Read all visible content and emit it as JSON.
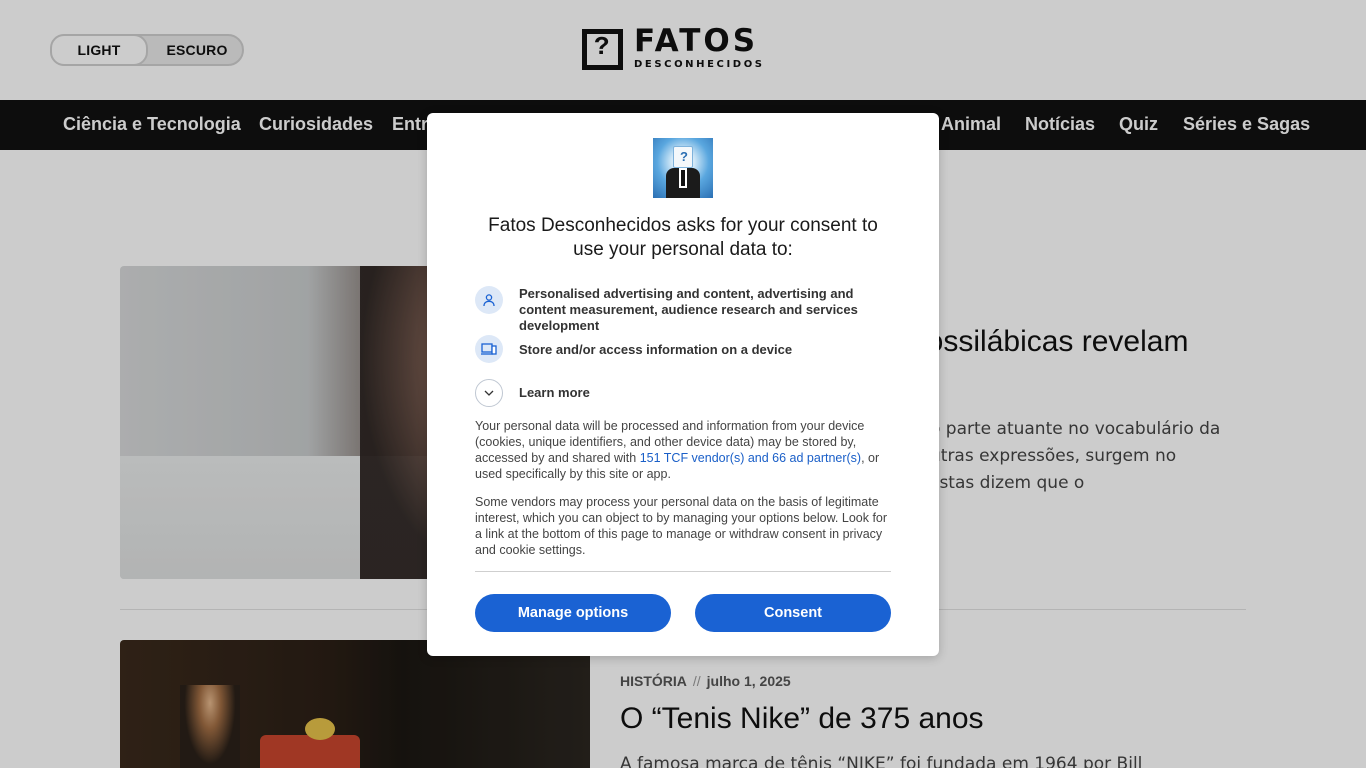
{
  "header": {
    "theme_light": "LIGHT",
    "theme_dark": "ESCURO",
    "logo_mark": "?",
    "logo_word": "FATOS",
    "logo_sub": "DESCONHECIDOS"
  },
  "nav": {
    "items": [
      "Ciência e Tecnologia",
      "Curiosidades",
      "Entr",
      "Animal",
      "Notícias",
      "Quiz",
      "Séries e Sagas"
    ]
  },
  "articles": [
    {
      "title_visible": "nossilábicas revelam",
      "excerpt_visible": "o parte atuante no vocabulário da\nutras expressões, surgem no\nlistas dizem que o"
    },
    {
      "category": "HISTÓRIA",
      "separator": "//",
      "date": "julho 1, 2025",
      "title": "O “Tenis Nike” de 375 anos",
      "excerpt": "A famosa marca de tênis “NIKE” foi fundada em 1964 por Bill"
    }
  ],
  "consent": {
    "title": "Fatos Desconhecidos asks for your consent to use your personal data to:",
    "purposes": [
      {
        "icon": "person-icon",
        "text": "Personalised advertising and content, advertising and content measurement, audience research and services development"
      },
      {
        "icon": "device-icon",
        "text": "Store and/or access information on a device"
      }
    ],
    "learn_more": "Learn more",
    "body_1_pre": "Your personal data will be processed and information from your device (cookies, unique identifiers, and other device data) may be stored by, accessed by and shared with ",
    "body_1_link": "151 TCF vendor(s) and 66 ad partner(s)",
    "body_1_post": ", or used specifically by this site or app.",
    "body_2": "Some vendors may process your personal data on the basis of legitimate interest, which you can object to by managing your options below. Look for a link at the bottom of this page to manage or withdraw consent in privacy and cookie settings.",
    "manage_button": "Manage options",
    "consent_button": "Consent",
    "accent_color": "#1a62d3",
    "link_color": "#1a5fc8"
  }
}
